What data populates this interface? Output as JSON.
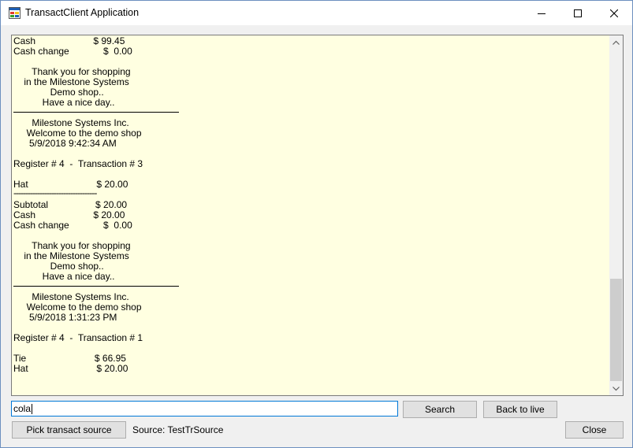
{
  "window": {
    "title": "TransactClient Application"
  },
  "receipt": {
    "lines": [
      {
        "t": "text",
        "s": "Cash                      $ 99.45"
      },
      {
        "t": "text",
        "s": "Cash change             $  0.00"
      },
      {
        "t": "text",
        "s": ""
      },
      {
        "t": "text",
        "s": "       Thank you for shopping"
      },
      {
        "t": "text",
        "s": "    in the Milestone Systems"
      },
      {
        "t": "text",
        "s": "              Demo shop.."
      },
      {
        "t": "text",
        "s": "           Have a nice day.."
      },
      {
        "t": "rule"
      },
      {
        "t": "text",
        "s": "       Milestone Systems Inc."
      },
      {
        "t": "text",
        "s": "     Welcome to the demo shop"
      },
      {
        "t": "text",
        "s": "      5/9/2018 9:42:34 AM"
      },
      {
        "t": "text",
        "s": ""
      },
      {
        "t": "text",
        "s": "Register # 4  -  Transaction # 3"
      },
      {
        "t": "text",
        "s": ""
      },
      {
        "t": "text",
        "s": "Hat                          $ 20.00"
      },
      {
        "t": "dashes",
        "s": "------------------------------------"
      },
      {
        "t": "text",
        "s": "Subtotal                  $ 20.00"
      },
      {
        "t": "text",
        "s": "Cash                      $ 20.00"
      },
      {
        "t": "text",
        "s": "Cash change             $  0.00"
      },
      {
        "t": "text",
        "s": ""
      },
      {
        "t": "text",
        "s": "       Thank you for shopping"
      },
      {
        "t": "text",
        "s": "    in the Milestone Systems"
      },
      {
        "t": "text",
        "s": "              Demo shop.."
      },
      {
        "t": "text",
        "s": "           Have a nice day.."
      },
      {
        "t": "rule"
      },
      {
        "t": "text",
        "s": "       Milestone Systems Inc."
      },
      {
        "t": "text",
        "s": "     Welcome to the demo shop"
      },
      {
        "t": "text",
        "s": "      5/9/2018 1:31:23 PM"
      },
      {
        "t": "text",
        "s": ""
      },
      {
        "t": "text",
        "s": "Register # 4  -  Transaction # 1"
      },
      {
        "t": "text",
        "s": ""
      },
      {
        "t": "text",
        "s": "Tie                          $ 66.95"
      },
      {
        "t": "text",
        "s": "Hat                          $ 20.00"
      }
    ]
  },
  "search": {
    "value": "cola",
    "button": "Search"
  },
  "back_to_live": {
    "label": "Back to live"
  },
  "pick_source": {
    "label": "Pick transact source"
  },
  "source": {
    "text": "Source: TestTrSource"
  },
  "close": {
    "label": "Close"
  },
  "colors": {
    "receipt_bg": "#ffffe1",
    "focus_border": "#0078d7"
  },
  "icons": {
    "app": "app-window-icon",
    "minimize": "minimize-icon",
    "maximize": "maximize-icon",
    "close": "close-x-icon"
  }
}
